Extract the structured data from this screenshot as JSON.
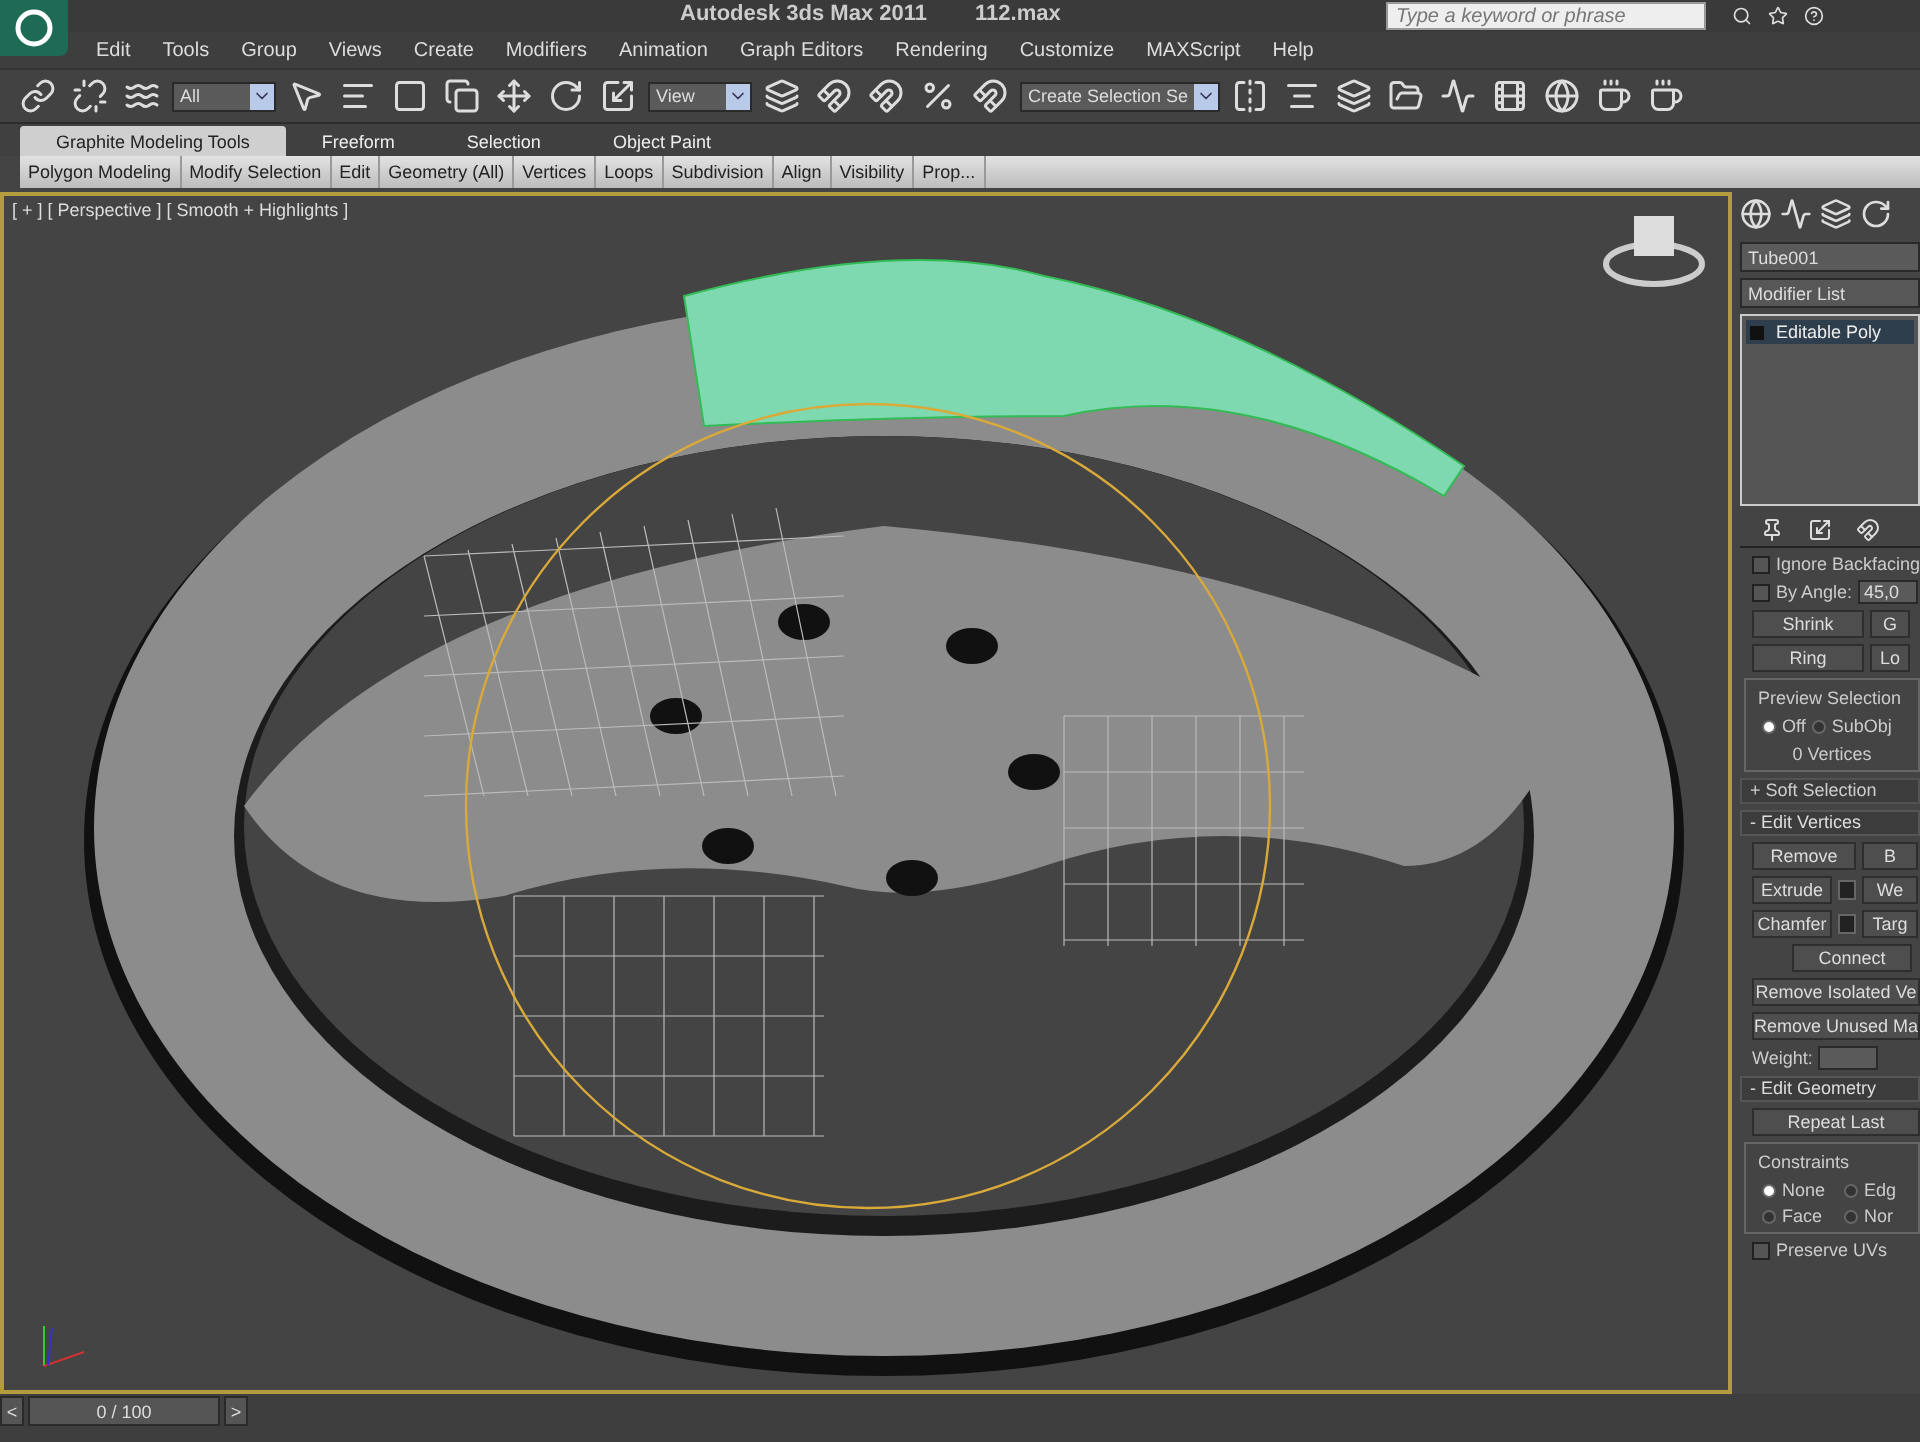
{
  "title_bar": {
    "title": "Autodesk 3ds Max  2011",
    "file": "112.max",
    "search": {
      "placeholder": "Type a keyword or phrase"
    }
  },
  "menu": [
    "Edit",
    "Tools",
    "Group",
    "Views",
    "Create",
    "Modifiers",
    "Animation",
    "Graph Editors",
    "Rendering",
    "Customize",
    "MAXScript",
    "Help"
  ],
  "toolbar": {
    "filter_dropdown": "All",
    "coord_dropdown": "View",
    "selection_set_dropdown": "Create Selection Se"
  },
  "ribbon": {
    "tabs": [
      {
        "label": "Graphite Modeling Tools",
        "selected": true
      },
      {
        "label": "Freeform",
        "selected": false
      },
      {
        "label": "Selection",
        "selected": false
      },
      {
        "label": "Object Paint",
        "selected": false
      }
    ],
    "panels": [
      "Polygon Modeling",
      "Modify Selection",
      "Edit",
      "Geometry (All)",
      "Vertices",
      "Loops",
      "Subdivision",
      "Align",
      "Visibility",
      "Prop..."
    ]
  },
  "viewport": {
    "label": "[ + ] [ Perspective ] [ Smooth + Highlights ]"
  },
  "timeline": {
    "prev": "<",
    "frame": "0 / 100",
    "next": ">"
  },
  "command_panel": {
    "object_name": "Tube001",
    "modifier_list": "Modifier List",
    "stack": [
      {
        "label": "Editable Poly",
        "selected": true
      }
    ],
    "selection": {
      "options": [
        {
          "label": "Ignore Backfacing",
          "checked": false
        },
        {
          "label": "By Angle:",
          "checked": false
        }
      ],
      "angle": "45,0",
      "buttons": [
        [
          "Shrink",
          "G"
        ],
        [
          "Ring",
          "Lo"
        ]
      ],
      "preview_title": "Preview Selection",
      "preview_options": [
        {
          "label": "Off",
          "selected": true
        },
        {
          "label": "SubObj",
          "selected": false
        }
      ],
      "count": "0 Vertices"
    },
    "rollouts": [
      {
        "sign": "+",
        "title": "Soft Selection",
        "expanded": false
      },
      {
        "sign": "-",
        "title": "Edit Vertices",
        "expanded": true
      }
    ],
    "vertex_buttons": [
      {
        "label": "Remove",
        "kind": "plain",
        "right": "B"
      },
      {
        "label": "Extrude",
        "kind": "with_settings",
        "right": "We"
      },
      {
        "label": "Chamfer",
        "kind": "with_settings",
        "right": "Targ"
      }
    ],
    "connect": "Connect",
    "wide_buttons": [
      "Remove Isolated Ve",
      "Remove Unused Ma"
    ],
    "weight": "Weight:",
    "geometry": {
      "sign": "-",
      "title": "Edit Geometry",
      "repeat": "Repeat Last",
      "constraints_title": "Constraints",
      "constraints": [
        {
          "label": "None",
          "selected": true
        },
        {
          "label": "Edg",
          "selected": false
        },
        {
          "label": "Face",
          "selected": false
        },
        {
          "label": "Nor",
          "selected": false
        }
      ],
      "preserve": {
        "label": "Preserve UVs",
        "checked": false
      }
    }
  }
}
